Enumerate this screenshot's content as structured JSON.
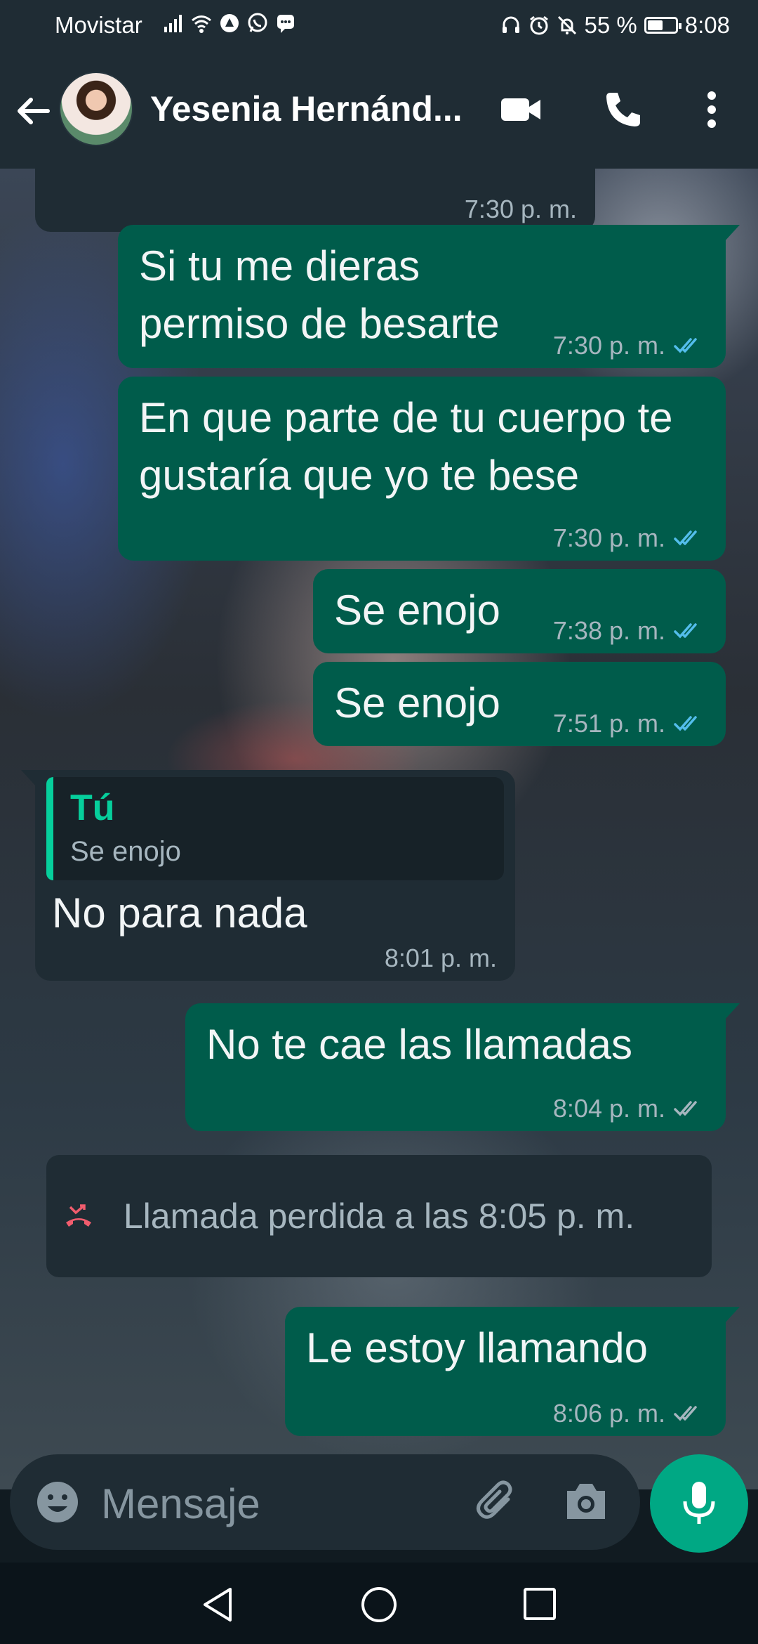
{
  "status_bar": {
    "carrier": "Movistar",
    "battery": "55 %",
    "battery_level": 0.55,
    "time": "8:08"
  },
  "header": {
    "contact_name": "Yesenia Hernánd...",
    "icons": [
      "back-arrow-icon",
      "video-call-icon",
      "phone-call-icon",
      "more-options-icon"
    ]
  },
  "messages": [
    {
      "direction": "in",
      "time": "7:30 p. m."
    },
    {
      "direction": "out",
      "text": "Si tu me dieras permiso de besarte",
      "time": "7:30 p. m.",
      "status": "read"
    },
    {
      "direction": "out",
      "text": "En que parte de tu cuerpo te gustaría que yo te bese",
      "time": "7:30 p. m.",
      "status": "read"
    },
    {
      "direction": "out",
      "text": "Se enojo",
      "time": "7:38 p. m.",
      "status": "read"
    },
    {
      "direction": "out",
      "text": "Se enojo",
      "time": "7:51 p. m.",
      "status": "read"
    },
    {
      "direction": "in",
      "quote_author": "Tú",
      "quote_text": "Se enojo",
      "text": "No para nada",
      "time": "8:01 p. m."
    },
    {
      "direction": "out",
      "text": "No te cae las llamadas",
      "time": "8:04 p. m.",
      "status": "delivered"
    },
    {
      "type": "missed_call",
      "text": "Llamada perdida a las 8:05 p. m."
    },
    {
      "direction": "out",
      "text": "Le estoy llamando",
      "time": "8:06 p. m.",
      "status": "delivered"
    }
  ],
  "input": {
    "placeholder": "Mensaje"
  },
  "colors": {
    "header_bg": "#1f2c34",
    "outgoing_bubble": "#005c4b",
    "incoming_bubble": "#1f2c34",
    "accent": "#00a884",
    "read_ticks": "#53bdeb",
    "missed_call": "#f15c6d"
  }
}
